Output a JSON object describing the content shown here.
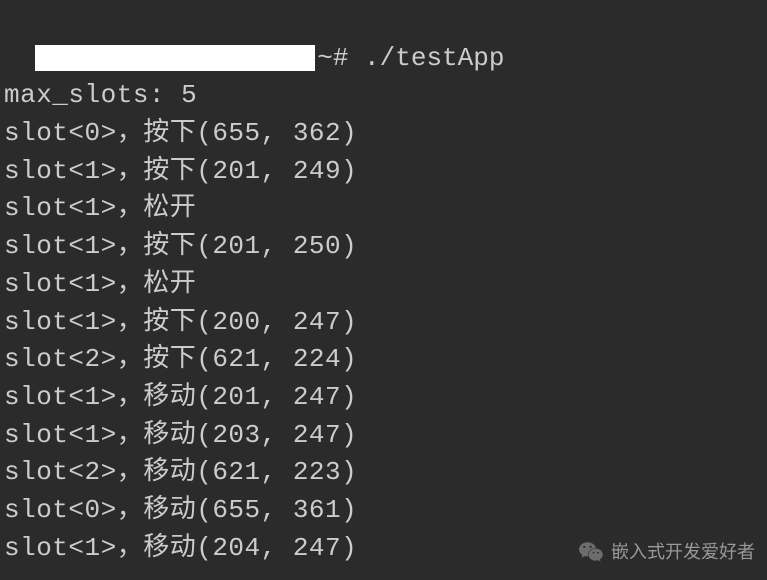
{
  "prompt": {
    "suffix": "~# ",
    "command": "./testApp"
  },
  "header_line": "max_slots: 5",
  "lines": [
    "slot<0>，按下(655, 362)",
    "slot<1>，按下(201, 249)",
    "slot<1>，松开",
    "slot<1>，按下(201, 250)",
    "slot<1>，松开",
    "slot<1>，按下(200, 247)",
    "slot<2>，按下(621, 224)",
    "slot<1>，移动(201, 247)",
    "slot<1>，移动(203, 247)",
    "slot<2>，移动(621, 223)",
    "slot<0>，移动(655, 361)",
    "slot<1>，移动(204, 247)"
  ],
  "watermark": {
    "text": "嵌入式开发爱好者"
  }
}
